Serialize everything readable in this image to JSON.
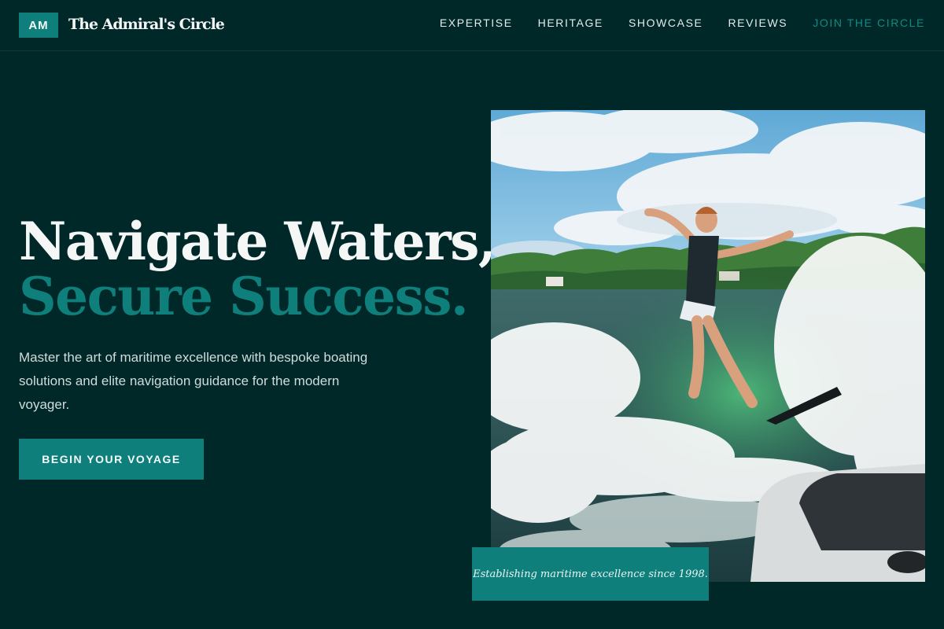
{
  "brand": {
    "badge": "AM",
    "name": "The Admiral's Circle"
  },
  "nav": {
    "links": [
      "EXPERTISE",
      "HERITAGE",
      "SHOWCASE",
      "REVIEWS"
    ],
    "cta": "JOIN THE CIRCLE"
  },
  "hero": {
    "headline_line1": "Navigate Waters,",
    "headline_line2": "Secure Success.",
    "lede": "Master the art of maritime excellence with bespoke boating solutions and elite navigation guidance for the modern voyager.",
    "cta_label": "BEGIN YOUR VOYAGE",
    "caption": "Establishing maritime excellence since 1998."
  },
  "colors": {
    "background": "#012829",
    "accent": "#0f7f7c",
    "text": "#f4f7f6"
  }
}
